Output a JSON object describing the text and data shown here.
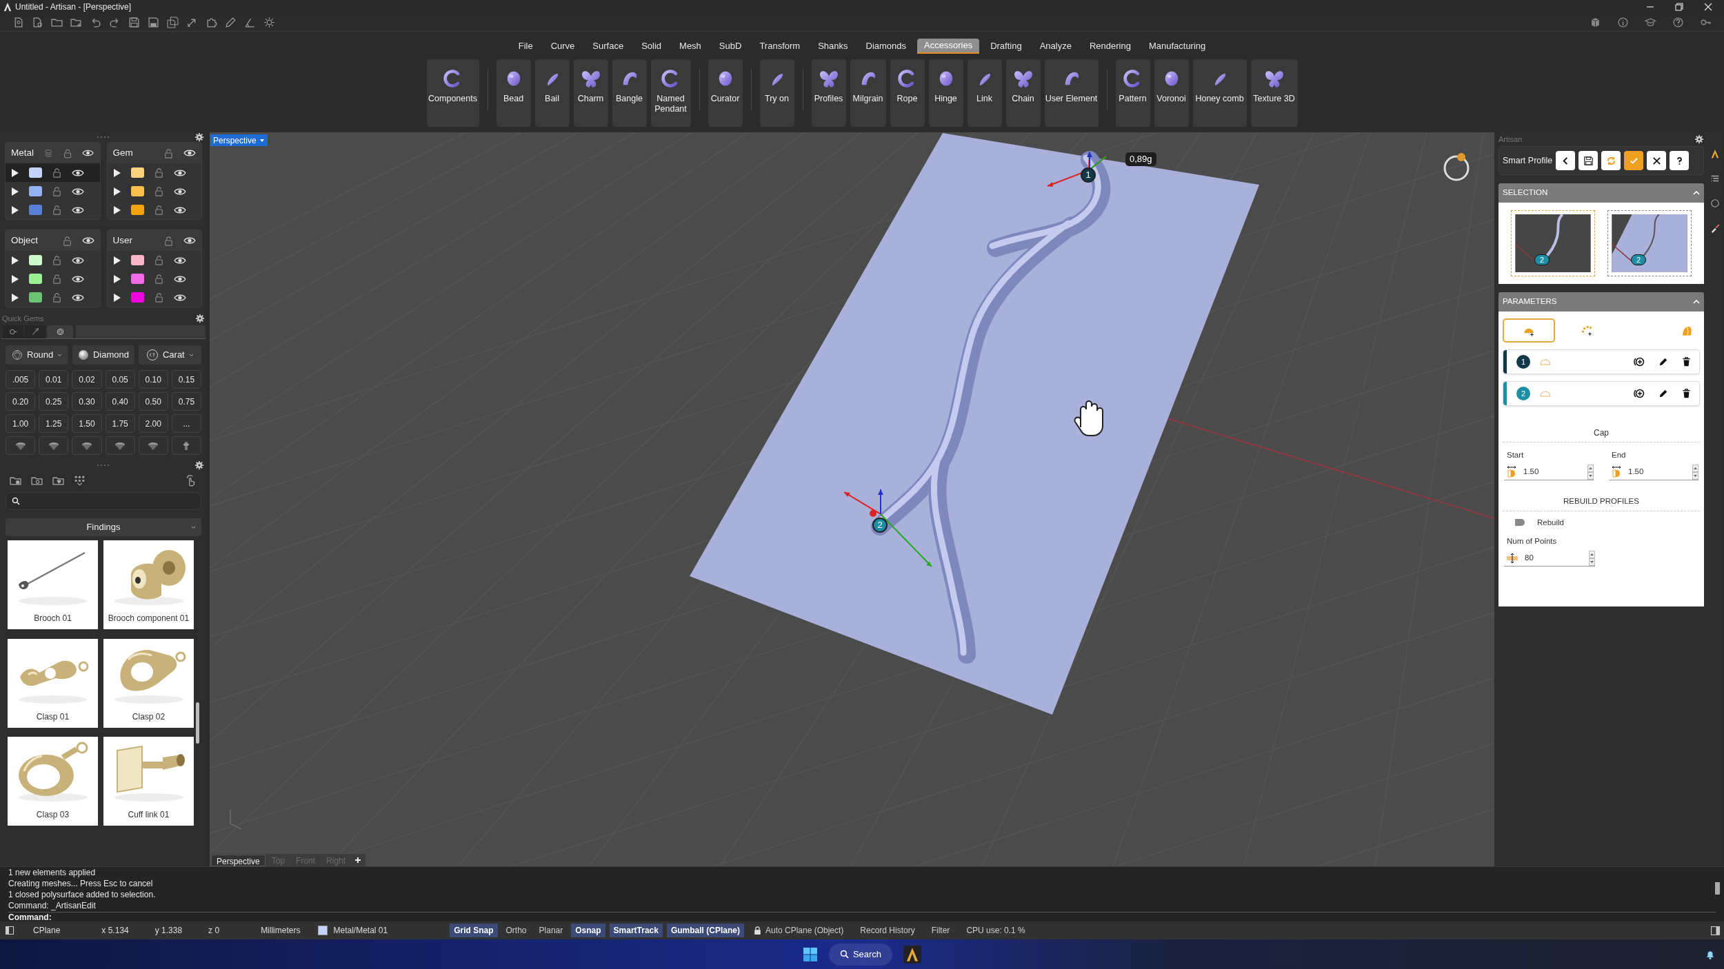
{
  "title_bar": {
    "title": "Untitled - Artisan - [Perspective]"
  },
  "menu": [
    {
      "label": "File",
      "selected": false
    },
    {
      "label": "Curve",
      "selected": false
    },
    {
      "label": "Surface",
      "selected": false
    },
    {
      "label": "Solid",
      "selected": false
    },
    {
      "label": "Mesh",
      "selected": false
    },
    {
      "label": "SubD",
      "selected": false
    },
    {
      "label": "Transform",
      "selected": false
    },
    {
      "label": "Shanks",
      "selected": false
    },
    {
      "label": "Diamonds",
      "selected": false
    },
    {
      "label": "Accessories",
      "selected": true
    },
    {
      "label": "Drafting",
      "selected": false
    },
    {
      "label": "Analyze",
      "selected": false
    },
    {
      "label": "Rendering",
      "selected": false
    },
    {
      "label": "Manufacturing",
      "selected": false
    }
  ],
  "ribbon_groups": [
    [
      "Components"
    ],
    [
      "Bead",
      "Bail",
      "Charm",
      "Bangle",
      "Named Pendant"
    ],
    [
      "Curator"
    ],
    [
      "Try on"
    ],
    [
      "Profiles",
      "Milgrain",
      "Rope",
      "Hinge",
      "Link",
      "Chain",
      "User Element"
    ],
    [
      "Pattern",
      "Voronoi",
      "Honey comb",
      "Texture 3D"
    ]
  ],
  "layers": [
    {
      "name": "Metal",
      "material_icon": true,
      "rows": [
        {
          "color": "#c5d3fb",
          "selected": true
        },
        {
          "color": "#95b1f2",
          "selected": false
        },
        {
          "color": "#5a7fd6",
          "selected": false
        }
      ]
    },
    {
      "name": "Gem",
      "material_icon": false,
      "rows": [
        {
          "color": "#fcd27e",
          "selected": false
        },
        {
          "color": "#fbbd4b",
          "selected": false
        },
        {
          "color": "#f5a410",
          "selected": false
        }
      ]
    },
    {
      "name": "Object",
      "material_icon": false,
      "rows": [
        {
          "color": "#cdfbcb",
          "selected": false
        },
        {
          "color": "#9cef94",
          "selected": false
        },
        {
          "color": "#6bc374",
          "selected": false
        }
      ]
    },
    {
      "name": "User",
      "material_icon": false,
      "rows": [
        {
          "color": "#f8b6c8",
          "selected": false
        },
        {
          "color": "#f36ae8",
          "selected": false
        },
        {
          "color": "#ee05e0",
          "selected": false
        }
      ]
    }
  ],
  "quick_gems": {
    "title": "Quick Gems",
    "tabs": [
      {
        "selected": false
      },
      {
        "selected": false
      },
      {
        "selected": true
      }
    ],
    "shape": "Round",
    "material": "Diamond",
    "unit": "Carat",
    "sizes": [
      ".005",
      "0.01",
      "0.02",
      "0.05",
      "0.10",
      "0.15",
      "0.20",
      "0.25",
      "0.30",
      "0.40",
      "0.50",
      "0.75",
      "1.00",
      "1.25",
      "1.50",
      "1.75",
      "2.00",
      "..."
    ]
  },
  "library": {
    "category": "Findings",
    "items": [
      {
        "label": "Brooch 01",
        "kind": "picture"
      },
      {
        "label": "Brooch component 01",
        "kind": "picture"
      },
      {
        "label": "Clasp 01",
        "kind": "picture"
      },
      {
        "label": "Clasp 02",
        "kind": "picture"
      },
      {
        "label": "Clasp 03",
        "kind": "picture"
      },
      {
        "label": "Cuff link 01",
        "kind": "picture"
      }
    ]
  },
  "viewport": {
    "label": "Perspective",
    "weight_label": "0,89g",
    "markers": [
      "1",
      "2"
    ],
    "tabs": [
      {
        "label": "Perspective",
        "selected": true
      },
      {
        "label": "Top",
        "selected": false
      },
      {
        "label": "Front",
        "selected": false
      },
      {
        "label": "Right",
        "selected": false
      }
    ]
  },
  "artisan_panel": {
    "title": "Artisan",
    "tool": "Smart Profile",
    "selection": {
      "title": "SELECTION",
      "thumbnails": [
        {
          "marker": "2",
          "selected": true
        },
        {
          "marker": "2",
          "selected": false
        }
      ]
    },
    "parameters": {
      "title": "PARAMETERS",
      "modes": [
        {
          "selected": true
        },
        {
          "selected": false
        }
      ],
      "profiles": [
        {
          "number": "1",
          "color": "#12394a"
        },
        {
          "number": "2",
          "color": "#1d8ea3"
        }
      ],
      "cap": {
        "title": "Cap",
        "start_label": "Start",
        "start": "1.50",
        "end_label": "End",
        "end": "1.50"
      },
      "rebuild": {
        "title": "REBUILD PROFILES",
        "label": "Rebuild",
        "on": false,
        "points_label": "Num of Points",
        "points": "80"
      }
    }
  },
  "command": {
    "history": [
      "1 new elements applied",
      "Creating meshes... Press Esc to cancel",
      "1 closed polysurface added to selection.",
      "Command: _ArtisanEdit"
    ],
    "prompt": "Command:"
  },
  "status_bar": {
    "cplane": "CPlane",
    "x": "x 5.134",
    "y": "y 1.338",
    "z": "z 0",
    "units": "Millimeters",
    "layer": {
      "label": "Metal/Metal 01",
      "color": "#c5d3fb"
    },
    "toggles": [
      {
        "label": "Grid Snap",
        "on": true
      },
      {
        "label": "Ortho",
        "on": false
      },
      {
        "label": "Planar",
        "on": false
      },
      {
        "label": "Osnap",
        "on": true
      },
      {
        "label": "SmartTrack",
        "on": true
      },
      {
        "label": "Gumball (CPlane)",
        "on": true
      }
    ],
    "auto_cplane": "Auto CPlane (Object)",
    "record": "Record History",
    "filter": "Filter",
    "cpu": "CPU use: 0.1 %"
  },
  "taskbar": {
    "search": "Search"
  }
}
